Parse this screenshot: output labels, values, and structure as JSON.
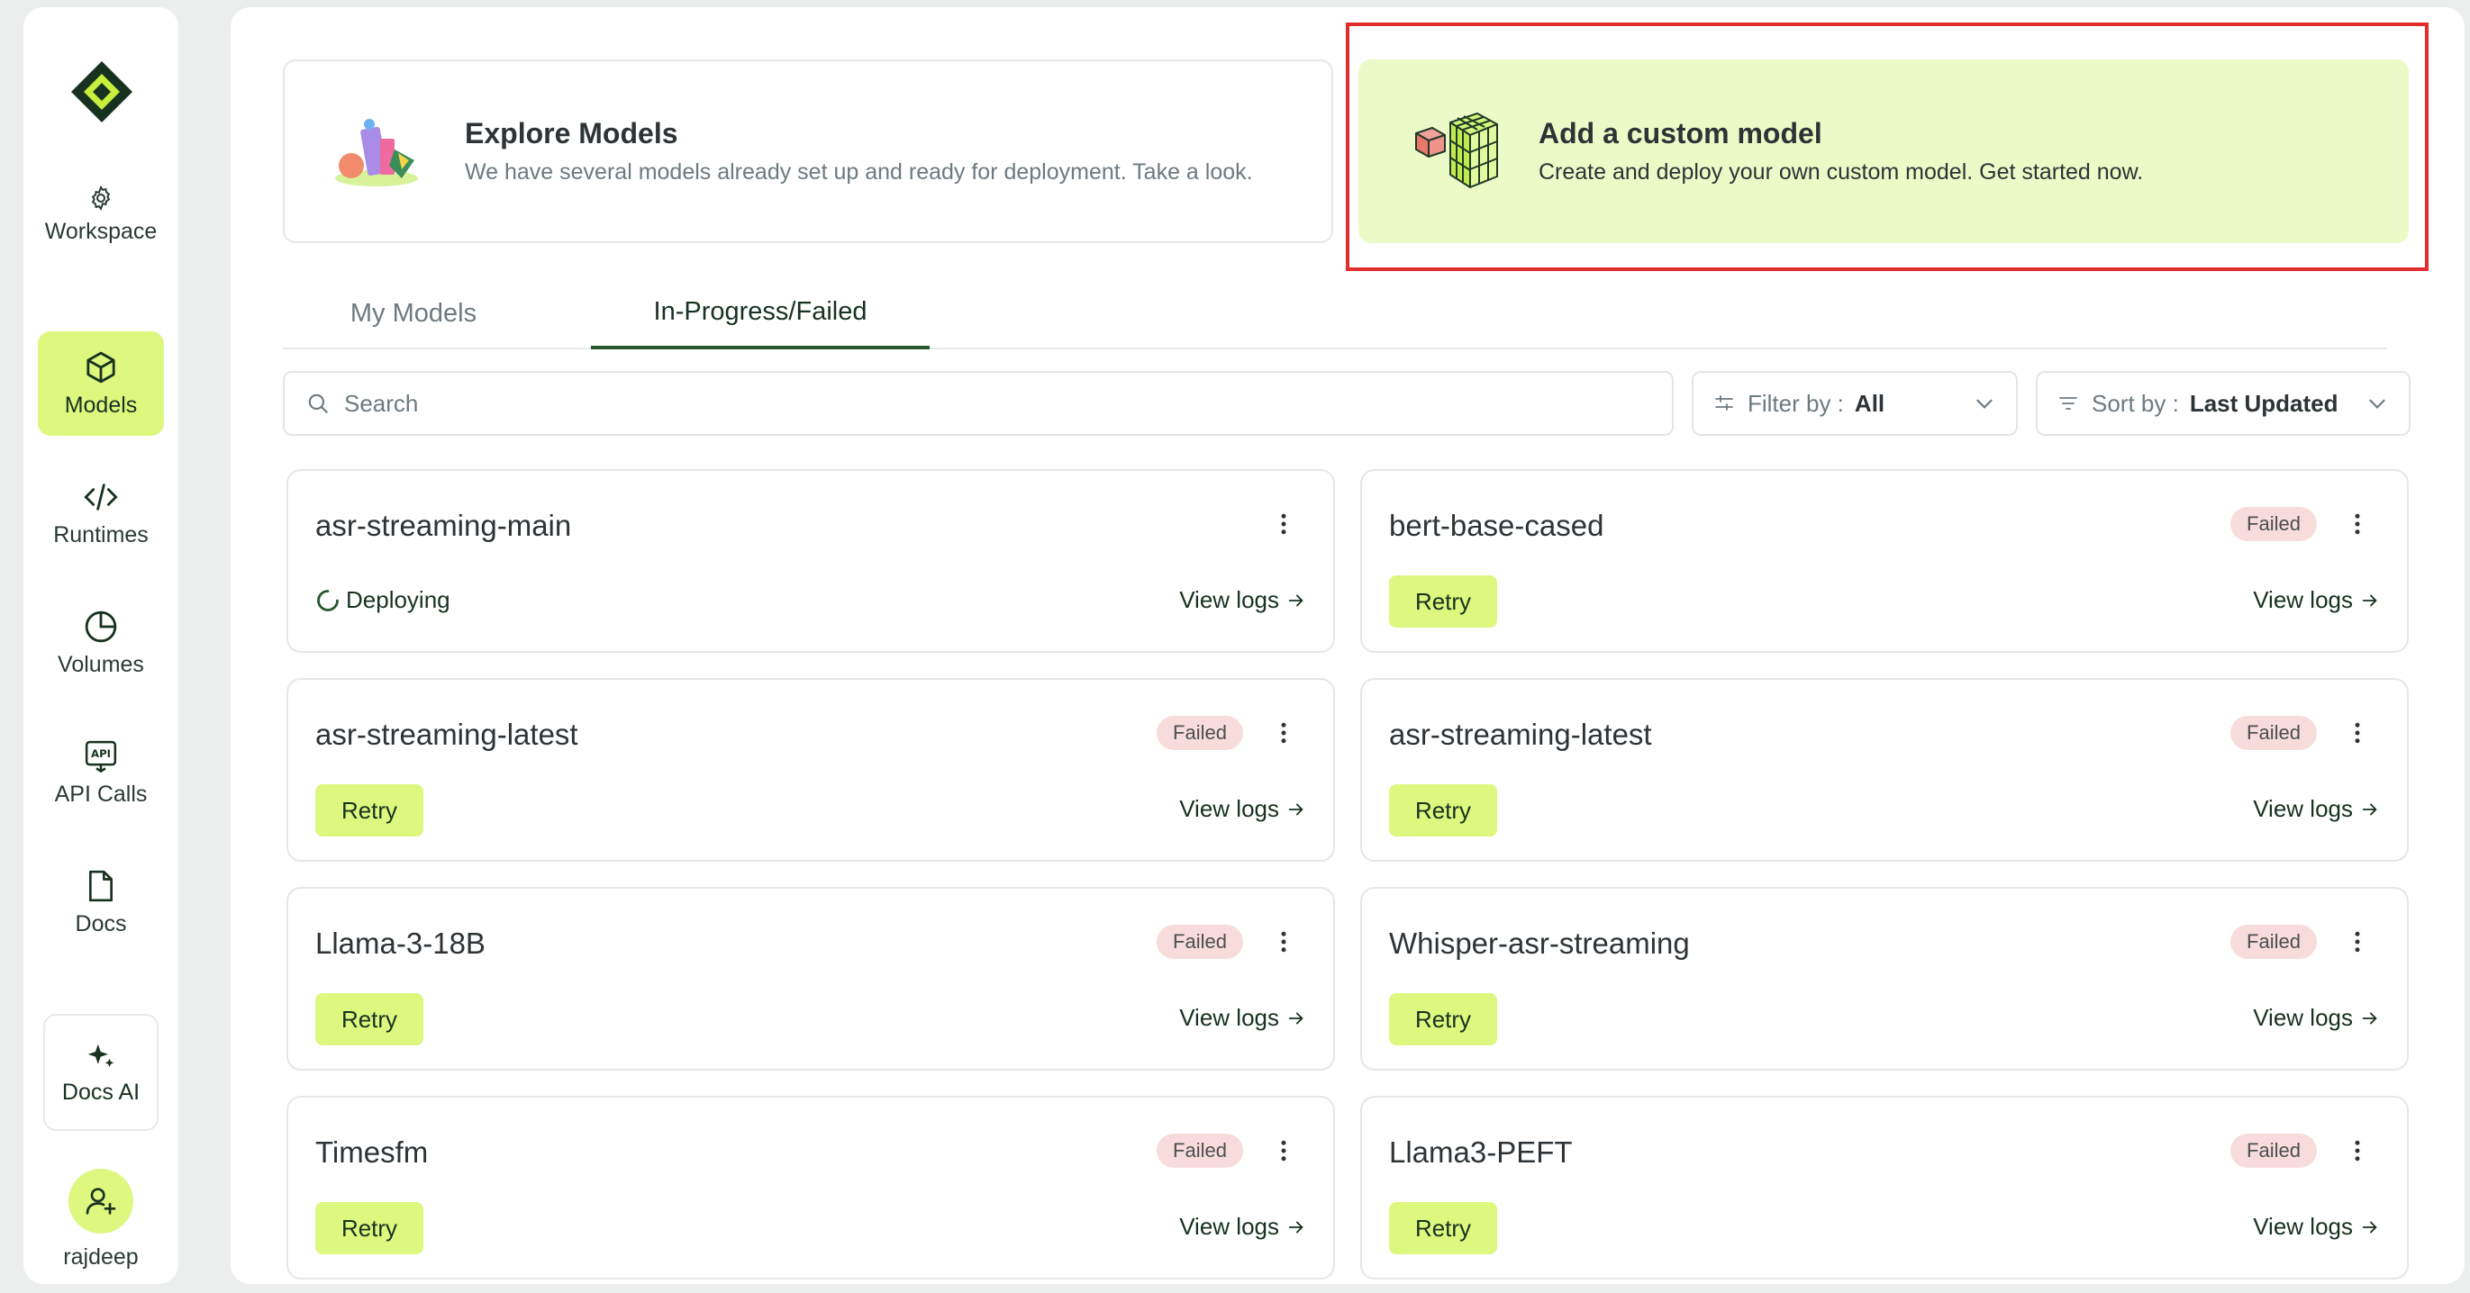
{
  "sidebar": {
    "workspace_label": "Workspace",
    "items": [
      {
        "label": "Models",
        "icon": "cube-icon",
        "active": true
      },
      {
        "label": "Runtimes",
        "icon": "code-icon"
      },
      {
        "label": "Volumes",
        "icon": "pie-chart-icon"
      },
      {
        "label": "API Calls",
        "icon": "api-icon"
      },
      {
        "label": "Docs",
        "icon": "document-icon"
      }
    ],
    "docs_ai_label": "Docs AI",
    "user_name": "rajdeep"
  },
  "banners": {
    "explore": {
      "title": "Explore Models",
      "desc": "We have several models already set up and ready for deployment. Take a look."
    },
    "custom": {
      "title": "Add a custom model",
      "desc": "Create and deploy your own custom model. Get started now."
    }
  },
  "tabs": [
    "My Models",
    "In-Progress/Failed"
  ],
  "search": {
    "placeholder": "Search"
  },
  "filter": {
    "key": "Filter by :",
    "value": "All"
  },
  "sort": {
    "key": "Sort by :",
    "value": "Last Updated"
  },
  "labels": {
    "retry": "Retry",
    "view_logs": "View logs",
    "failed": "Failed",
    "deploying": "Deploying"
  },
  "cards": [
    {
      "name": "asr-streaming-main",
      "status": "Deploying"
    },
    {
      "name": "bert-base-cased",
      "status": "Failed"
    },
    {
      "name": "asr-streaming-latest",
      "status": "Failed"
    },
    {
      "name": "asr-streaming-latest",
      "status": "Failed"
    },
    {
      "name": "Llama-3-18B",
      "status": "Failed"
    },
    {
      "name": "Whisper-asr-streaming",
      "status": "Failed"
    },
    {
      "name": "Timesfm",
      "status": "Failed"
    },
    {
      "name": "Llama3-PEFT",
      "status": "Failed"
    }
  ],
  "colors": {
    "accent": "#def77f",
    "dark_green": "#17321f",
    "failed_bg": "#f8dcdc",
    "highlight": "#e32d2d"
  }
}
